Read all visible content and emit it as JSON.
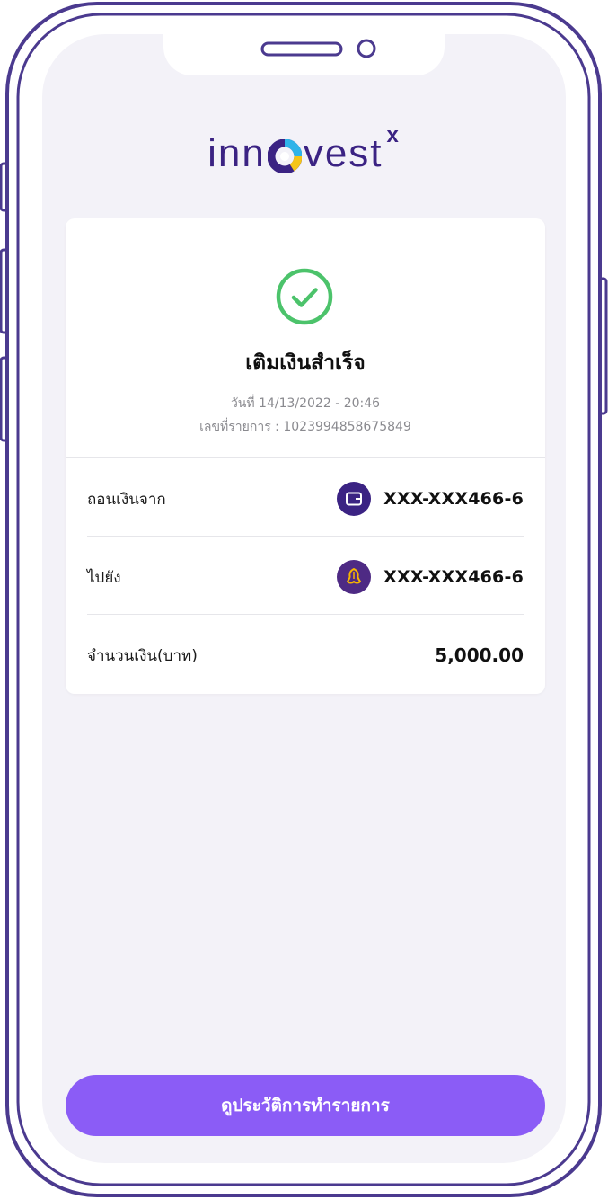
{
  "brand": {
    "logo_text_left": "inn",
    "logo_text_right": "vest",
    "logo_superscript": "x",
    "logo_colors": {
      "primary": "#3b2383",
      "accent_yellow": "#f5c518",
      "accent_blue": "#2fb4e9"
    }
  },
  "result": {
    "title": "เติมเงินสำเร็จ",
    "date_text": "วันที่ 14/13/2022 - 20:46",
    "ref_text": "เลขที่รายการ : 1023994858675849",
    "status_icon": "check-circle-icon",
    "status_color": "#4cc36b"
  },
  "details": {
    "from": {
      "label": "ถอนเงินจาก",
      "account": "XXX-XXX466-6",
      "icon": "wallet-icon",
      "badge_color": "#3b2383"
    },
    "to": {
      "label": "ไปยัง",
      "account": "XXX-XXX466-6",
      "icon": "bank-icon",
      "badge_color": "#4e2a84",
      "icon_color": "#f7b500"
    },
    "amount": {
      "label": "จำนวนเงิน(บาท)",
      "value": "5,000.00"
    }
  },
  "actions": {
    "history_button": "ดูประวัติการทำรายการ",
    "button_color": "#8b5cf6"
  }
}
